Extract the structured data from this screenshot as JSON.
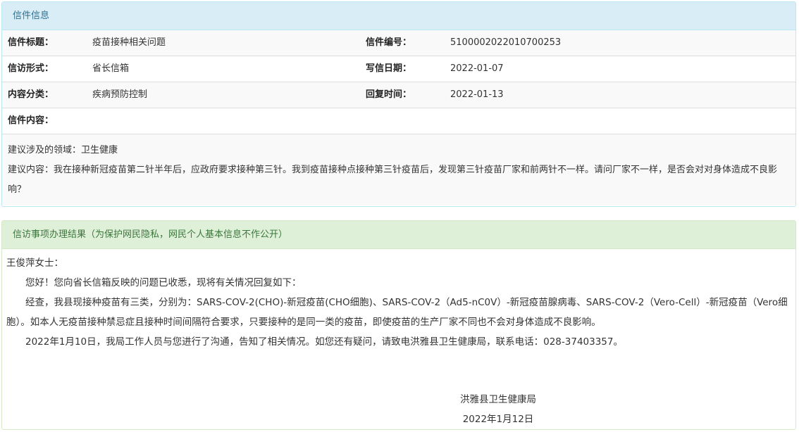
{
  "letter_info": {
    "heading": "信件信息",
    "rows": [
      {
        "label1": "信件标题：",
        "value1": "疫苗接种相关问题",
        "label2": "信件编号：",
        "value2": "5100002022010700253"
      },
      {
        "label1": "信访形式：",
        "value1": "省长信箱",
        "label2": "写信日期：",
        "value2": "2022-01-07"
      },
      {
        "label1": "内容分类：",
        "value1": "疾病预防控制",
        "label2": "回复时间：",
        "value2": "2022-01-13"
      }
    ],
    "content_label": "信件内容：",
    "content_lines": [
      "建议涉及的领域：卫生健康",
      "建议内容：我在接种新冠疫苗第二针半年后，应政府要求接种第三针。我到疫苗接种点接种第三针疫苗后，发现第三针疫苗厂家和前两针不一样。请问厂家不一样，是否会对对身体造成不良影响？"
    ]
  },
  "reply": {
    "heading": "信访事项办理结果（为保护网民隐私，网民个人基本信息不作公开）",
    "salutation": "王俊萍女士：",
    "paragraphs": [
      "您好！您向省长信箱反映的问题已收悉，现将有关情况回复如下：",
      "经查，我县现接种疫苗有三类，分别为：SARS-COV-2(CHO)-新冠疫苗(CHO细胞)、SARS-COV-2（Ad5-nC0V）-新冠疫苗腺病毒、SARS-COV-2（Vero-Cell）-新冠疫苗（Vero细胞）。如本人无疫苗接种禁忌症且接种时间间隔符合要求，只要接种的是同一类的疫苗，即使疫苗的生产厂家不同也不会对身体造成不良影响。",
      "2022年1月10日，我局工作人员与您进行了沟通，告知了相关情况。如您还有疑问，请致电洪雅县卫生健康局，联系电话：028-37403357。"
    ],
    "signature_org": "洪雅县卫生健康局",
    "signature_date": "2022年1月12日"
  },
  "colors": {
    "info_heading_bg": "#d9edf7",
    "info_heading_text": "#31708f",
    "success_heading_bg": "#dff0d8",
    "success_heading_text": "#3c763d"
  }
}
